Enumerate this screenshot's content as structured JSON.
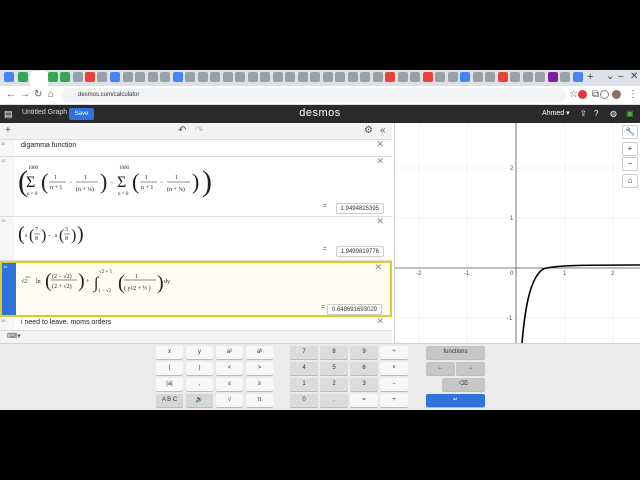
{
  "browser": {
    "url": "desmos.com/calculator"
  },
  "desmos": {
    "graph_title": "Untitled Graph",
    "save_label": "Save",
    "logo": "desmos",
    "user": "Ahmed"
  },
  "expressions": [
    {
      "num": "11",
      "text": "digamma function"
    },
    {
      "num": "12",
      "result": "1.9494825395"
    },
    {
      "num": "13",
      "result": "1.9499819776"
    },
    {
      "num": "14",
      "result": "0.648691693029"
    },
    {
      "num": "15",
      "text": "i need to leave. moms orders"
    }
  ],
  "graph": {
    "x_ticks": [
      "-2",
      "-1",
      "0",
      "1",
      "2"
    ],
    "y_ticks": [
      "2",
      "1",
      "-1"
    ]
  },
  "keypad": {
    "left": [
      [
        "x",
        "y",
        "a²",
        "aᵇ"
      ],
      [
        "(",
        ")",
        "<",
        ">"
      ],
      [
        "|a|",
        ",",
        "≤",
        "≥"
      ],
      [
        "A B C",
        "🔊",
        "√",
        "π"
      ]
    ],
    "numbers": [
      [
        "7",
        "8",
        "9",
        "÷"
      ],
      [
        "4",
        "5",
        "6",
        "×"
      ],
      [
        "1",
        "2",
        "3",
        "−"
      ],
      [
        "0",
        ".",
        "=",
        "+"
      ]
    ],
    "functions_label": "functions"
  }
}
